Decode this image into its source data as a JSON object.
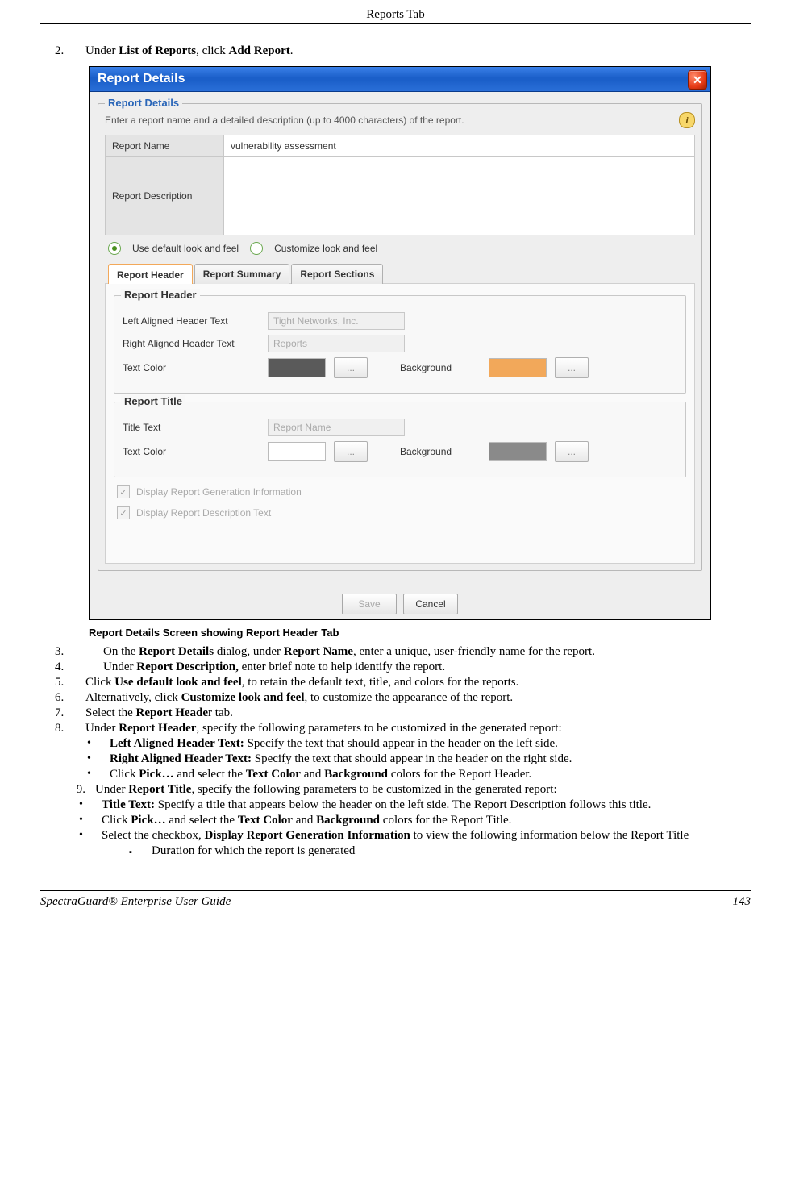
{
  "header": {
    "title": "Reports Tab"
  },
  "footer": {
    "left": "SpectraGuard®  Enterprise User Guide",
    "right": "143"
  },
  "step2": {
    "num": "2.",
    "pre": "Under ",
    "b1": "List of Reports",
    "mid": ", click ",
    "b2": "Add Report",
    "post": "."
  },
  "caption": "Report Details Screen showing Report Header Tab",
  "step3": {
    "num": "3.",
    "pre": "On the ",
    "b1": "Report Details",
    "mid": " dialog, under ",
    "b2": "Report Name",
    "post": ", enter a unique, user-friendly name for the report."
  },
  "step4": {
    "num": "4.",
    "pre": "Under ",
    "b1": "Report Description,",
    "post": " enter brief note to help identify the report."
  },
  "step5": {
    "num": "5.",
    "pre": "Click ",
    "b1": "Use default look and feel",
    "post": ", to retain the default text, title, and colors for the reports."
  },
  "step6": {
    "num": "6.",
    "pre": "Alternatively, click ",
    "b1": "Customize look and feel",
    "post": ", to customize the appearance of the report."
  },
  "step7": {
    "num": "7.",
    "pre": "Select the ",
    "b1": "Report Heade",
    "post": "r tab."
  },
  "step8": {
    "num": "8.",
    "pre": "Under ",
    "b1": "Report Header",
    "post": ", specify the following parameters to be customized in the generated report:"
  },
  "step8b1": {
    "b": "Left Aligned Header Text:",
    "t": " Specify the text that should appear in the header on the left side."
  },
  "step8b2": {
    "b": "Right Aligned Header Text:",
    "t": " Specify the text that should appear in the header on the right side."
  },
  "step8b3": {
    "pre": "Click ",
    "b1": "Pick…",
    "mid": " and select the ",
    "b2": "Text Color",
    "mid2": " and ",
    "b3": "Background",
    "post": " colors for the Report Header."
  },
  "step9": {
    "num": "9.",
    "pre": "Under ",
    "b1": "Report Title",
    "post": ", specify the following parameters to be customized in the generated report:"
  },
  "step9b1": {
    "b": "Title Text:",
    "t": " Specify a title that appears below the header on the left side. The Report Description follows this title."
  },
  "step9b2": {
    "pre": "Click ",
    "b1": "Pick…",
    "mid": " and select the ",
    "b2": "Text Color",
    "mid2": " and ",
    "b3": "Background",
    "post": " colors for the Report Title."
  },
  "step9b3": {
    "pre": "Select the checkbox, ",
    "b1": "Display Report Generation Information",
    "post": " to view the following information below the Report Title"
  },
  "step9s1": "Duration for which the report is generated",
  "win": {
    "title": "Report Details",
    "group_legend": "Report Details",
    "hint": "Enter a report name and a detailed description (up to 4000 characters) of the report.",
    "name_label": "Report Name",
    "name_value": "vulnerability assessment",
    "desc_label": "Report Description",
    "desc_value": "",
    "radio_default": "Use default look and feel",
    "radio_custom": "Customize look and feel",
    "tabs": {
      "header": "Report Header",
      "summary": "Report Summary",
      "sections": "Report Sections"
    },
    "rh_legend": "Report Header",
    "rh_left_label": "Left Aligned Header Text",
    "rh_left_value": "Tight Networks, Inc.",
    "rh_right_label": "Right Aligned Header Text",
    "rh_right_value": "Reports",
    "textcolor_label": "Text Color",
    "background_label": "Background",
    "ellipsis": "...",
    "colors": {
      "rh_text": "#5a5a5a",
      "rh_bg": "#f2a85a",
      "rt_text": "#ffffff",
      "rt_bg": "#8a8a8a"
    },
    "rt_legend": "Report Title",
    "rt_title_label": "Title Text",
    "rt_title_value": "Report Name",
    "chk_gen": "Display Report Generation Information",
    "chk_desc": "Display Report Description Text",
    "save": "Save",
    "cancel": "Cancel"
  }
}
